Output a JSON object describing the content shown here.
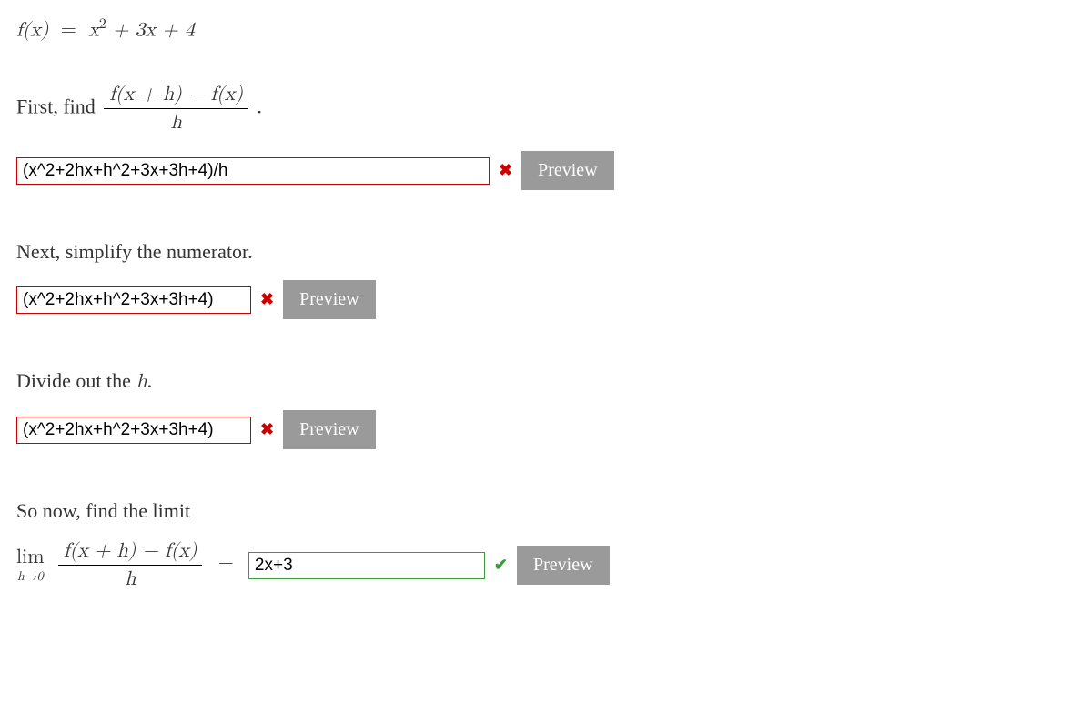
{
  "formula": {
    "lhs": "f(x)",
    "rhs_a": "x",
    "rhs_exp": "2",
    "rhs_b": " + 3x + 4"
  },
  "step1": {
    "text_a": "First, find ",
    "frac_num": "f(x + h) − f(x)",
    "frac_den": "h",
    "text_b": ".",
    "input": "(x^2+2hx+h^2+3x+3h+4)/h",
    "input_width": 520
  },
  "step2": {
    "text": "Next, simplify the numerator.",
    "input": "(x^2+2hx+h^2+3x+3h+4)",
    "input_width": 258
  },
  "step3": {
    "text_a": "Divide out the ",
    "var": "h",
    "text_b": ".",
    "input": "(x^2+2hx+h^2+3x+3h+4)",
    "input_width": 258
  },
  "step4": {
    "text": "So now, find the limit",
    "lim": "lim",
    "lim_sub": "h→0",
    "frac_num": "f(x + h) − f(x)",
    "frac_den": "h",
    "eq": "=",
    "input": "2x+3",
    "input_width": 260
  },
  "marks": {
    "wrong": "✖",
    "right": "✔"
  },
  "buttons": {
    "preview": "Preview"
  }
}
